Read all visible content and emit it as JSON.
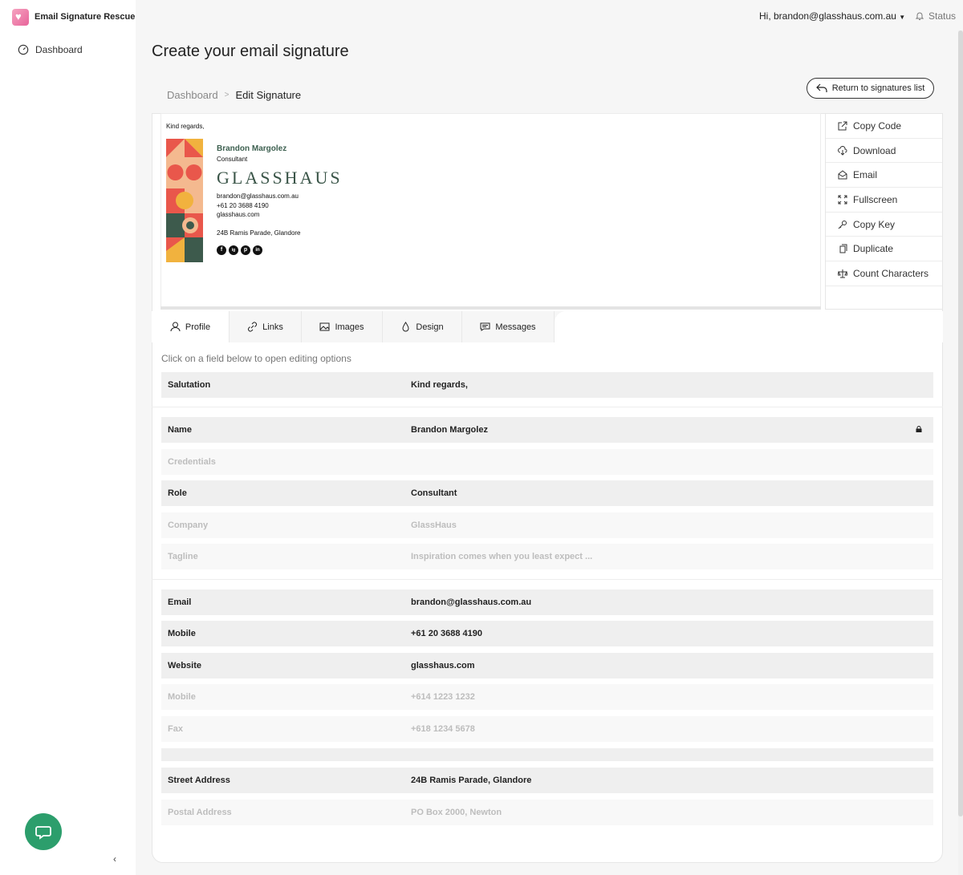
{
  "app": {
    "name": "Email Signature Rescue"
  },
  "sidebar": {
    "items": [
      {
        "label": "Dashboard",
        "icon": "gauge-icon"
      }
    ],
    "collapse_glyph": "‹"
  },
  "topbar": {
    "greeting": "Hi, brandon@glasshaus.com.au",
    "status": "Status"
  },
  "page": {
    "title": "Create your email signature"
  },
  "breadcrumb": {
    "parent": "Dashboard",
    "separator": ">",
    "current": "Edit Signature"
  },
  "return_button": "Return to signatures list",
  "signature": {
    "salutation": "Kind regards,",
    "name": "Brandon Margolez",
    "role": "Consultant",
    "logo": "GLASSHAUS",
    "email": "brandon@glasshaus.com.au",
    "phone": "+61 20 3688 4190",
    "website": "glasshaus.com",
    "address": "24B Ramis Parade, Glandore",
    "social": [
      "f",
      "ig",
      "p",
      "in"
    ]
  },
  "actions": [
    "Copy Code",
    "Download",
    "Email",
    "Fullscreen",
    "Copy Key",
    "Duplicate",
    "Count Characters"
  ],
  "tabs": [
    {
      "label": "Profile",
      "icon": "user-icon"
    },
    {
      "label": "Links",
      "icon": "link-icon"
    },
    {
      "label": "Images",
      "icon": "image-icon"
    },
    {
      "label": "Design",
      "icon": "droplet-icon"
    },
    {
      "label": "Messages",
      "icon": "message-icon"
    }
  ],
  "hint": "Click on a field below to open editing options",
  "fields": {
    "salutation": {
      "label": "Salutation",
      "value": "Kind regards,"
    },
    "name": {
      "label": "Name",
      "value": "Brandon Margolez"
    },
    "credentials": {
      "label": "Credentials",
      "value": ""
    },
    "role": {
      "label": "Role",
      "value": "Consultant"
    },
    "company": {
      "label": "Company",
      "value": "GlassHaus"
    },
    "tagline": {
      "label": "Tagline",
      "value": "Inspiration comes when you least expect ..."
    },
    "email": {
      "label": "Email",
      "value": "brandon@glasshaus.com.au"
    },
    "mobile": {
      "label": "Mobile",
      "value": "+61 20 3688 4190"
    },
    "website": {
      "label": "Website",
      "value": "glasshaus.com"
    },
    "mobile2": {
      "label": "Mobile",
      "value": "+614 1223 1232"
    },
    "fax": {
      "label": "Fax",
      "value": "+618 1234 5678"
    },
    "street": {
      "label": "Street Address",
      "value": "24B Ramis Parade, Glandore"
    },
    "postal": {
      "label": "Postal Address",
      "value": "PO Box 2000, Newton"
    }
  },
  "colors": {
    "accent": "#2c9e6c",
    "brand_green": "#3d6050"
  }
}
